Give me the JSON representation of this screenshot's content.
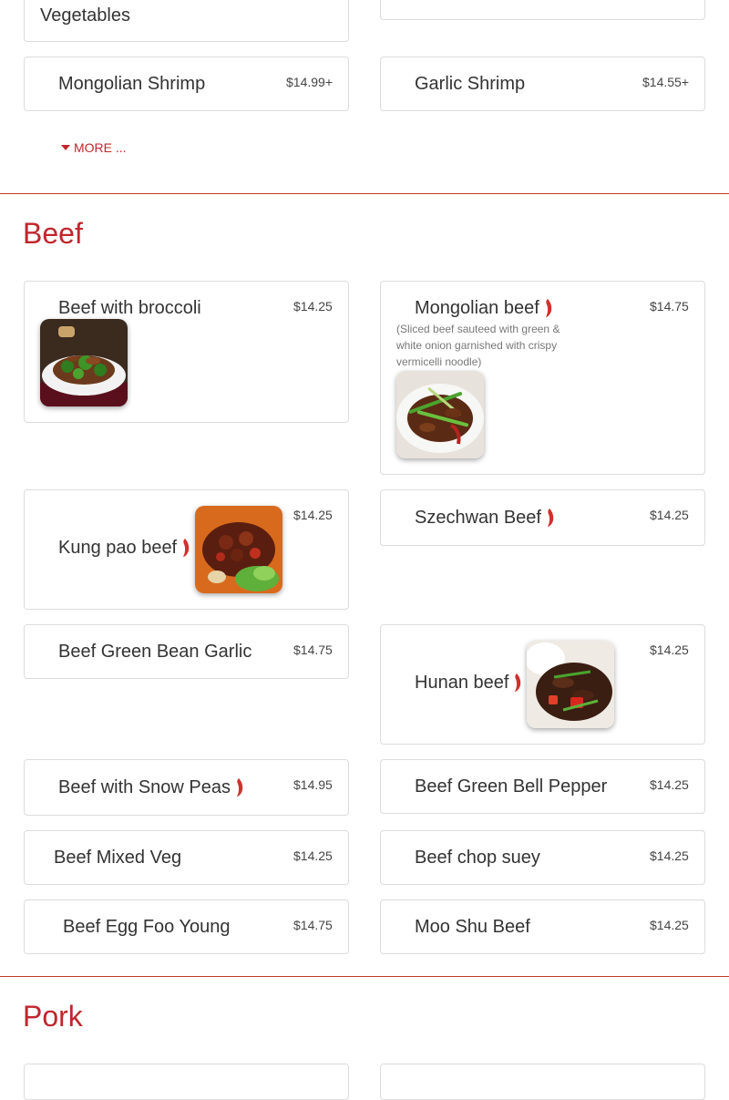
{
  "top_cards": {
    "partial_left_name": "Vegetables",
    "mongolian_shrimp": {
      "name": "Mongolian Shrimp",
      "price": "$14.99+"
    },
    "garlic_shrimp": {
      "name": "Garlic Shrimp",
      "price": "$14.55+"
    },
    "more_label": "MORE ..."
  },
  "sections": {
    "beef_title": "Beef",
    "pork_title": "Pork"
  },
  "beef_items": [
    {
      "name": "Beef with broccoli",
      "price": "$14.25",
      "spicy": false,
      "has_image": true
    },
    {
      "name": "Mongolian beef",
      "price": "$14.75",
      "spicy": true,
      "has_image": true,
      "description": "(Sliced beef sauteed with green & white onion garnished with crispy vermicelli noodle)"
    },
    {
      "name": "Kung pao beef",
      "price": "$14.25",
      "spicy": true,
      "has_image": true
    },
    {
      "name": "Szechwan Beef",
      "price": "$14.25",
      "spicy": true,
      "has_image": false
    },
    {
      "name": "Beef Green Bean Garlic",
      "price": "$14.75",
      "spicy": false,
      "has_image": false
    },
    {
      "name": "Hunan beef",
      "price": "$14.25",
      "spicy": true,
      "has_image": true
    },
    {
      "name": "Beef with Snow Peas",
      "price": "$14.95",
      "spicy": true,
      "has_image": false
    },
    {
      "name": "Beef Green Bell Pepper",
      "price": "$14.25",
      "spicy": false,
      "has_image": false
    },
    {
      "name": "Beef Mixed Veg",
      "price": "$14.25",
      "spicy": false,
      "has_image": false
    },
    {
      "name": "Beef chop suey",
      "price": "$14.25",
      "spicy": false,
      "has_image": false
    },
    {
      "name": "Beef Egg Foo Young",
      "price": "$14.75",
      "spicy": false,
      "has_image": false
    },
    {
      "name": "Moo Shu Beef",
      "price": "$14.25",
      "spicy": false,
      "has_image": false
    }
  ],
  "icons": {
    "spicy": "chili-pepper-icon",
    "more": "caret-down-icon"
  },
  "colors": {
    "accent": "#c0272d",
    "pepper": "#d0312d",
    "card_border": "#dcdcdc",
    "divider": "#c0392b"
  }
}
